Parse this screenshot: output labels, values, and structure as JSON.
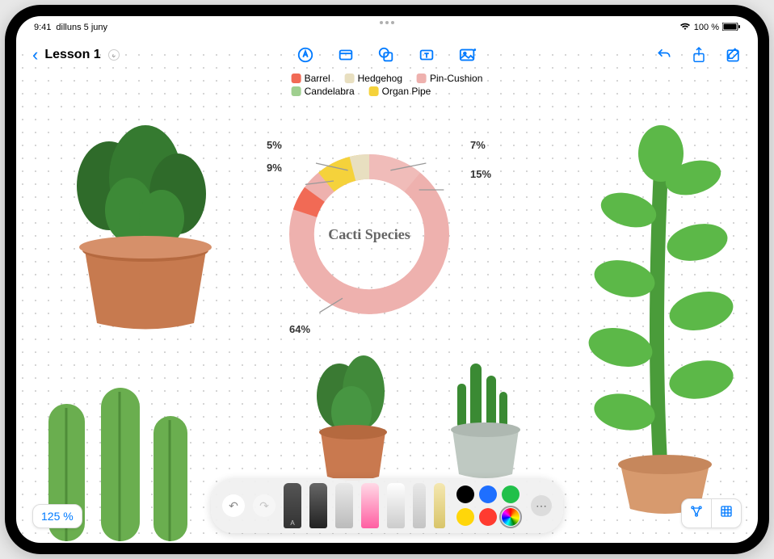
{
  "status": {
    "time": "9:41",
    "date": "dilluns 5 juny",
    "battery": "100 %"
  },
  "toolbar": {
    "doc_title": "Lesson 1"
  },
  "zoom": {
    "label": "125 %"
  },
  "chart_data": {
    "type": "pie",
    "title": "Cacti Species",
    "series": [
      {
        "name": "Barrel",
        "value": 5,
        "color": "#f16a55"
      },
      {
        "name": "Hedgehog",
        "value": 7,
        "color": "#e8dfc0"
      },
      {
        "name": "Pin-Cushion",
        "value": 15,
        "color": "#eeb1ae"
      },
      {
        "name": "Candelabra",
        "value": 64,
        "color": "#eeb1ae"
      },
      {
        "name": "Organ Pipe",
        "value": 9,
        "color": "#f5d23b"
      }
    ],
    "legend": [
      {
        "name": "Barrel",
        "color": "#f16a55"
      },
      {
        "name": "Hedgehog",
        "color": "#e8dfc0"
      },
      {
        "name": "Pin-Cushion",
        "color": "#eeb1ae"
      },
      {
        "name": "Candelabra",
        "color": "#9fcf8f"
      },
      {
        "name": "Organ Pipe",
        "color": "#f5d23b"
      }
    ],
    "labels": {
      "tl": "5%",
      "l": "9%",
      "tr": "7%",
      "r": "15%",
      "b": "64%"
    }
  },
  "dock": {
    "colors": [
      {
        "hex": "#000000"
      },
      {
        "hex": "#1e6fff"
      },
      {
        "hex": "#21c04a"
      },
      {
        "hex": "#ffd60a"
      },
      {
        "hex": "#ff3b30"
      },
      {
        "hex": "rainbow",
        "selected": true
      }
    ]
  }
}
